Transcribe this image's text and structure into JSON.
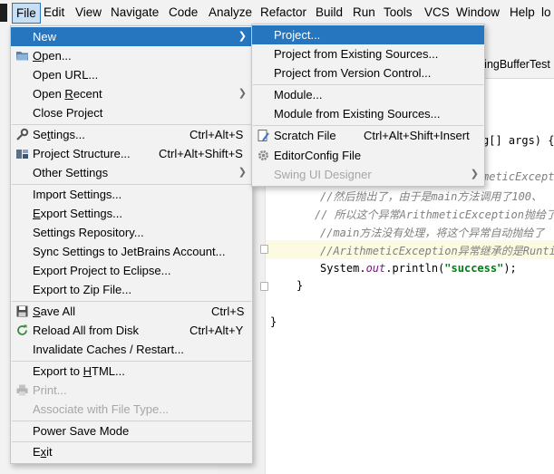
{
  "menubar": {
    "items": [
      "File",
      "Edit",
      "View",
      "Navigate",
      "Code",
      "Analyze",
      "Refactor",
      "Build",
      "Run",
      "Tools",
      "VCS",
      "Window",
      "Help",
      "lo"
    ]
  },
  "editor": {
    "tab": "ringBufferTest",
    "lines": {
      "args": "g[] args) {",
      "exc1": "meticExcept",
      "c1": "//然后抛出了，由于是main方法调用了100、",
      "c2": "// 所以这个异常ArithmeticException抛给了",
      "c3": "//main方法没有处理，将这个异常自动抛给了",
      "c4": "//ArithmeticException异常继承的是Runti",
      "print_a": "System.",
      "print_b": "out",
      "print_c": ".println(",
      "print_d": "\"success\"",
      "print_e": ");",
      "brace1": "}",
      "brace2": "}"
    }
  },
  "file_menu": {
    "items": [
      {
        "label": "New",
        "shortcut": "",
        "submenu": true,
        "selected": true
      },
      {
        "label": "Open...",
        "shortcut": "",
        "icon": "folder-icon"
      },
      {
        "label": "Open URL...",
        "shortcut": ""
      },
      {
        "label": "Open Recent",
        "shortcut": "",
        "submenu": true
      },
      {
        "label": "Close Project",
        "shortcut": ""
      },
      {
        "label": "Settings...",
        "shortcut": "Ctrl+Alt+S",
        "icon": "wrench-icon"
      },
      {
        "label": "Project Structure...",
        "shortcut": "Ctrl+Alt+Shift+S",
        "icon": "project-structure-icon"
      },
      {
        "label": "Other Settings",
        "shortcut": "",
        "submenu": true
      },
      {
        "label": "Import Settings...",
        "shortcut": ""
      },
      {
        "label": "Export Settings...",
        "shortcut": ""
      },
      {
        "label": "Settings Repository...",
        "shortcut": ""
      },
      {
        "label": "Sync Settings to JetBrains Account...",
        "shortcut": ""
      },
      {
        "label": "Export Project to Eclipse...",
        "shortcut": ""
      },
      {
        "label": "Export to Zip File...",
        "shortcut": ""
      },
      {
        "label": "Save All",
        "shortcut": "Ctrl+S",
        "icon": "save-icon"
      },
      {
        "label": "Reload All from Disk",
        "shortcut": "Ctrl+Alt+Y",
        "icon": "reload-icon"
      },
      {
        "label": "Invalidate Caches / Restart...",
        "shortcut": ""
      },
      {
        "label": "Export to HTML...",
        "shortcut": ""
      },
      {
        "label": "Print...",
        "shortcut": "",
        "icon": "print-icon",
        "disabled": true
      },
      {
        "label": "Associate with File Type...",
        "shortcut": "",
        "disabled": true
      },
      {
        "label": "Power Save Mode",
        "shortcut": ""
      },
      {
        "label": "Exit",
        "shortcut": ""
      }
    ]
  },
  "new_menu": {
    "items": [
      {
        "label": "Project...",
        "shortcut": "",
        "selected": true
      },
      {
        "label": "Project from Existing Sources...",
        "shortcut": ""
      },
      {
        "label": "Project from Version Control...",
        "shortcut": ""
      },
      {
        "label": "Module...",
        "shortcut": ""
      },
      {
        "label": "Module from Existing Sources...",
        "shortcut": ""
      },
      {
        "label": "Scratch File",
        "shortcut": "Ctrl+Alt+Shift+Insert",
        "icon": "scratch-file-icon"
      },
      {
        "label": "EditorConfig File",
        "shortcut": "",
        "icon": "gear-icon"
      },
      {
        "label": "Swing UI Designer",
        "shortcut": "",
        "submenu": true,
        "disabled": true
      }
    ]
  }
}
